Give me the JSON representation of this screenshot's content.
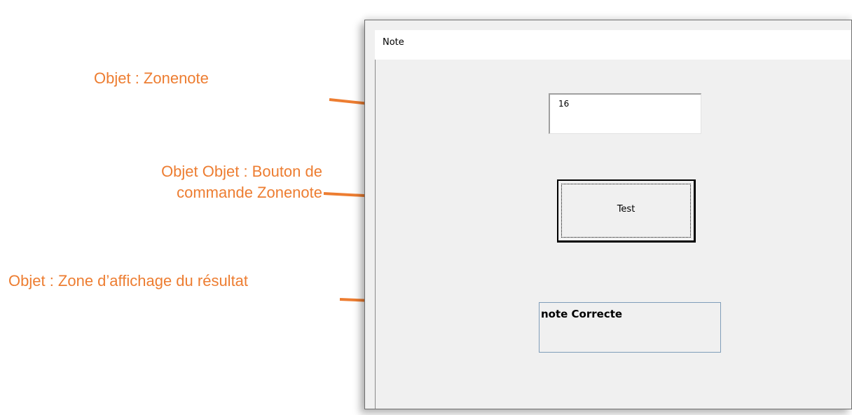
{
  "annotations": {
    "zonenote": "Objet : Zonenote",
    "button_line1": "Objet Objet : Bouton de",
    "button_line2": "commande Zonenote",
    "result": "Objet : Zone d’affichage du résultat"
  },
  "form": {
    "title": "Note",
    "textbox_value": "16",
    "button_label": "Test",
    "result_text": "note Correcte"
  },
  "colors": {
    "annotation": "#ed7d31",
    "form_background": "#f0f0f0",
    "result_border": "#7f9db9"
  }
}
